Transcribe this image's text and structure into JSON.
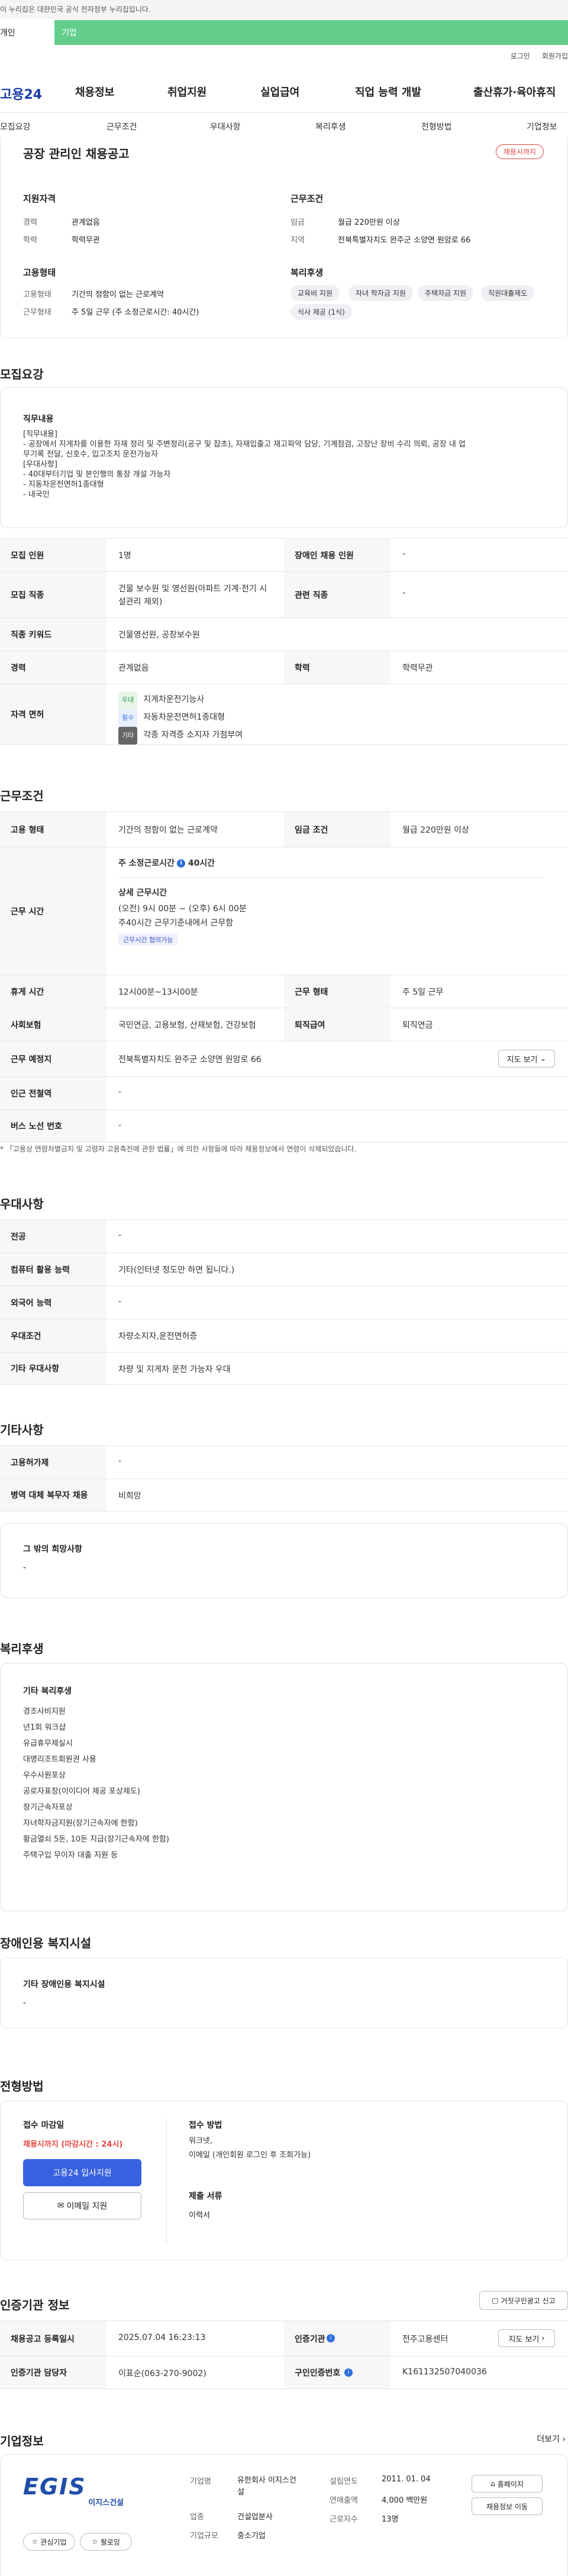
{
  "gov_notice": "이 누리집은 대한민국 공식 전자정부 누리집입니다.",
  "tabs": {
    "personal": "개인",
    "company": "기업"
  },
  "toplinks": {
    "login": "로그인",
    "signup": "회원가입"
  },
  "gnb": {
    "logo": "고용24",
    "items": [
      "채용정보",
      "취업지원",
      "실업급여",
      "직업 능력 개발",
      "출산휴가·육아휴직"
    ]
  },
  "lnb": [
    "모집요강",
    "근무조건",
    "우대사항",
    "복리후생",
    "전형방법",
    "기업정보"
  ],
  "summary": {
    "title": "공장 관리인 채용공고",
    "badge": "채용시까지",
    "qualify_h": "지원자격",
    "exp_l": "경력",
    "exp_v": "관계없음",
    "edu_l": "학력",
    "edu_v": "학력무관",
    "work_h": "근무조건",
    "wage_l": "임금",
    "wage_v": "월급 220만원 이상",
    "loc_l": "지역",
    "loc_v": "전북특별자치도 완주군 소양면 원암로 66",
    "emp_h": "고용형태",
    "emp_l": "고용형태",
    "emp_v": "기간의 정함이 없는 근로계약",
    "worktype_l": "근무형태",
    "worktype_v": "주 5일 근무 (주 소정근로시간: 40시간)",
    "welfare_h": "복리후생",
    "welfare_chips": [
      "교육비 지원",
      "자녀 학자금 지원",
      "주택자금 지원",
      "직원대출제도",
      "식사 제공 (1식)"
    ]
  },
  "recruit": {
    "title": "모집요강",
    "job_h": "직무내용",
    "job_lines": [
      "[직무내용]",
      "- 공장에서 지게차를 이용한 자재 정리 및 주변정리(공구 및 잡초), 자재입출고 재고파악 담당, 기계점검, 고장난 장비 수리 의뢰, 공장 내 업",
      "  무기록 전달, 신호수, 입고조치 운전가능자",
      "[우대사항]",
      "- 40대부터기업 및 본인행의 통장 개설 가능자",
      "- 지동차운전면허1종대형",
      "- 내국인"
    ],
    "rows": [
      {
        "th": "모집 인원",
        "td": "1명",
        "th2": "장애인 채용 인원",
        "td2": "-"
      },
      {
        "th": "모집 직종",
        "td": "건물 보수원 및 영선원(아파트 기계·전기 시설관리 제외)",
        "th2": "관련 직종",
        "td2": "-"
      },
      {
        "th": "직종 키워드",
        "td": "건물영선원, 공장보수원"
      },
      {
        "th": "경력",
        "td": "관계없음",
        "th2": "학력",
        "td2": "학력무관"
      },
      {
        "th": "자격 면허",
        "licenses": [
          {
            "tag": "우대",
            "text": "지게차운전기능사"
          },
          {
            "tag": "필수",
            "text": "자동차운전면허1종대형"
          },
          {
            "tag": "기타",
            "text": "각종 자격증 소지자 가점부여"
          }
        ]
      }
    ]
  },
  "conditions": {
    "title": "근무조건",
    "emp_th": "고용 형태",
    "emp_td": "기간의 정함이 없는 근로계약",
    "wage_th": "임금 조건",
    "wage_td": "월급 220만원 이상",
    "hours_th": "근무 시간",
    "hours_main": "주 소정근로시간",
    "hours_val": "40시간",
    "detail_h": "상세 근무시간",
    "detail_lines": [
      "(오전) 9시 00분 ~ (오후) 6시 00분",
      "주40시간 근무기준내에서 근무함"
    ],
    "detail_badge": "근무시간 협의가능",
    "rest_th": "휴게 시간",
    "rest_td": "12시00분~13시00분",
    "shift_th": "근무 형태",
    "shift_td": "주 5일 근무",
    "ins_th": "사회보험",
    "ins_td": "국민연금, 고용보험, 산재보험, 건강보험",
    "ret_th": "퇴직급여",
    "ret_td": "퇴직연금",
    "place_th": "근무 예정지",
    "place_td": "전북특별자치도 완주군 소양면 원암로 66",
    "map_btn": "지도 보기",
    "station_th": "인근 전철역",
    "station_td": "-",
    "bus_th": "버스 노선 번호",
    "bus_td": "-",
    "note": "* 「고용상 연령차별금지 및 고령자 고용촉진에 관한 법률」에 의한 사항들에 따라 채용정보에서 연령이 삭제되었습니다."
  },
  "pref": {
    "title": "우대사항",
    "rows": [
      {
        "th": "전공",
        "td": "-"
      },
      {
        "th": "컴퓨터 활용 능력",
        "td": "기타(인터넷 정도만 하면 됩니다.)"
      },
      {
        "th": "외국어 능력",
        "td": "-"
      },
      {
        "th": "우대조건",
        "td": "차량소지자,운전면허증"
      },
      {
        "th": "기타 우대사항",
        "td": "차량 및 지게차 운전 가능자 우대"
      }
    ]
  },
  "etc": {
    "title": "기타사항",
    "rows": [
      {
        "th": "고용허가제",
        "td": "-"
      },
      {
        "th": "병역 대체 복무자 채용",
        "td": "비희망"
      }
    ],
    "card_h": "그 밖의 희망사항",
    "card_v": "-"
  },
  "benefits": {
    "title": "복리후생",
    "card_h": "기타 복리후생",
    "items": [
      "경조사비지원",
      "년1회 워크샵",
      "유급휴무제실시",
      "대명리조트회원권 사용",
      "우수사원포상",
      "공로자표창(이이디어 제공 포상제도)",
      "장기근속자포상",
      "자녀학자금지원(장기근속자에 한함)",
      "황금열쇠 5돈, 10돈 지급(장기근속자에 한함)",
      "주택구입 무이자 대출 지원 등"
    ]
  },
  "disabled": {
    "title": "장애인용 복지시설",
    "card_h": "기타 장애인용 복지시설",
    "card_v": "-"
  },
  "apply": {
    "title": "전형방법",
    "deadline_h": "접수 마감일",
    "deadline_v": "채용시까지 (마감시간 : 24시)",
    "apply_btn": "고용24 입사지원",
    "email_btn": "이메일 지원",
    "method_h": "접수 방법",
    "method_lines": [
      "워크넷,",
      "이메일 (개인회원 로그인 후 조회가능)"
    ],
    "docs_h": "제출 서류",
    "docs_v": "이력서"
  },
  "agency": {
    "title": "인증기관 정보",
    "report_btn": "거짓구인광고 신고",
    "rows": [
      {
        "th": "채용공고 등록일시",
        "td": "2025.07.04 16:23:13",
        "th2": "인증기관",
        "td2": "전주고용센터",
        "btn": "지도 보기"
      },
      {
        "th": "인증기관 담당자",
        "td": "이표순(063-270-9002)",
        "th2": "구인인증번호",
        "td2": "K161132507040036"
      }
    ]
  },
  "company": {
    "title": "기업정보",
    "more": "더보기",
    "logo_text": "EGIS",
    "logo_sub": "이지스건설",
    "fav_btn": "관심기업",
    "follow_btn": "팔로잉",
    "fields": [
      {
        "l": "기업명",
        "v": "유한회사 이지스건설"
      },
      {
        "l": "업종",
        "v": "건설업분사"
      },
      {
        "l": "기업규모",
        "v": "중소기업"
      }
    ],
    "fields2": [
      {
        "l": "설립연도",
        "v": "2011. 01. 04"
      },
      {
        "l": "연매출액",
        "v": "4,000 백만원"
      },
      {
        "l": "근로자수",
        "v": "13명"
      }
    ],
    "home_btn": "홈페이지",
    "jobs_btn": "채용정보 이동"
  }
}
